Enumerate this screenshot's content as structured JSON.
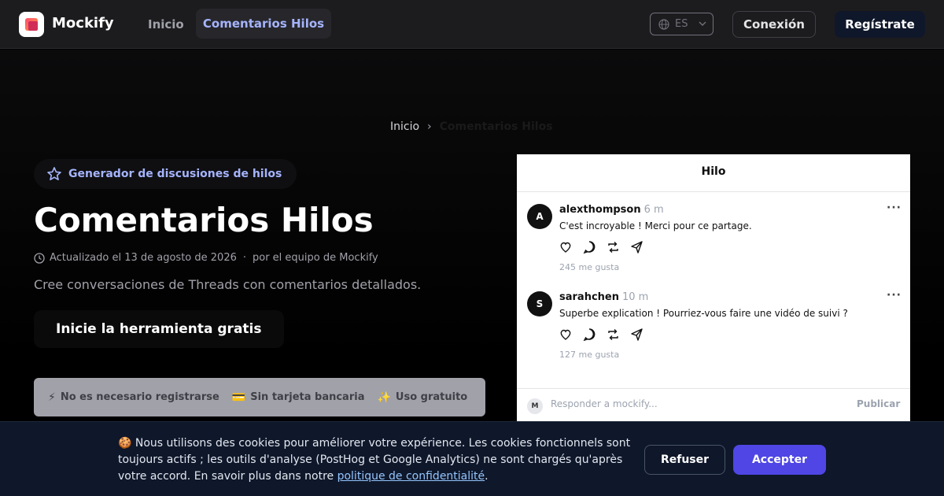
{
  "header": {
    "brand": "Mockify",
    "nav_home": "Inicio",
    "nav_active": "Comentarios Hilos",
    "language": "ES",
    "login_label": "Conexión",
    "signup_label": "Regístrate"
  },
  "breadcrumb": {
    "home": "Inicio",
    "separator": "›",
    "current": "Comentarios Hilos"
  },
  "hero": {
    "badge": "Generador de discusiones de hilos",
    "title": "Comentarios Hilos",
    "updated": "Actualizado el 13 de agosto de 2026",
    "meta_separator": "·",
    "author": "por el equipo de Mockify",
    "subtitle": "Cree conversaciones de Threads con comentarios detallados.",
    "cta_label": "Inicie la herramienta gratis",
    "features": [
      {
        "icon": "⚡",
        "label": "No es necesario registrarse"
      },
      {
        "icon": "💳",
        "label": "Sin tarjeta bancaria"
      },
      {
        "icon": "✨",
        "label": "Uso gratuito"
      }
    ]
  },
  "thread": {
    "header": "Hilo",
    "posts": [
      {
        "initial": "A",
        "username": "alexthompson",
        "time": "6 m",
        "text": "C'est incroyable ! Merci pour ce partage.",
        "likes": "245 me gusta"
      },
      {
        "initial": "S",
        "username": "sarahchen",
        "time": "10 m",
        "text": "Superbe explication ! Pourriez-vous faire une vidéo de suivi ?",
        "likes": "127 me gusta"
      }
    ],
    "more_glyph": "···",
    "reply_initial": "M",
    "reply_placeholder": "Responder a mockify...",
    "publish_label": "Publicar"
  },
  "cookie": {
    "text_before": "🍪 Nous utilisons des cookies pour améliorer votre expérience. Les cookies fonctionnels sont toujours actifs ; les outils d'analyse (PostHog et Google Analytics) ne sont chargés qu'après votre accord. En savoir plus dans notre ",
    "link": "politique de confidentialité",
    "text_after": ".",
    "refuse_label": "Refuser",
    "accept_label": "Accepter"
  },
  "colors": {
    "accent": "#a5b4fc",
    "accept_button": "#4f46e5",
    "banner_bg": "#0f172a"
  }
}
